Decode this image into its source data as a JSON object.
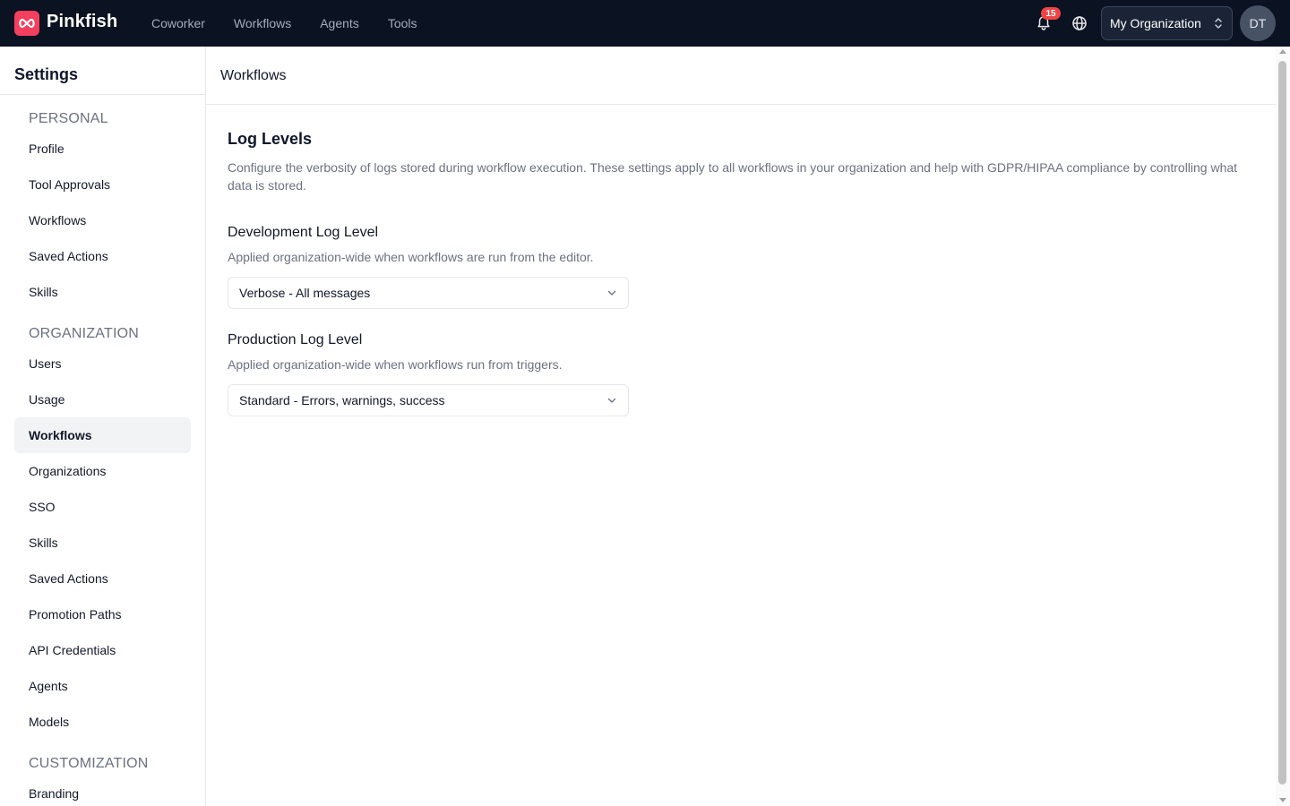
{
  "brand": {
    "name": "Pinkfish",
    "accent": "#f43f5e"
  },
  "topnav": [
    {
      "label": "Coworker"
    },
    {
      "label": "Workflows"
    },
    {
      "label": "Agents"
    },
    {
      "label": "Tools"
    }
  ],
  "header": {
    "notification_count": "15",
    "org_name": "My Organization",
    "avatar_initials": "DT"
  },
  "sidebar": {
    "title": "Settings",
    "sections": {
      "personal": {
        "heading": "PERSONAL",
        "items": [
          "Profile",
          "Tool Approvals",
          "Workflows",
          "Saved Actions",
          "Skills"
        ]
      },
      "organization": {
        "heading": "ORGANIZATION",
        "items": [
          "Users",
          "Usage",
          "Workflows",
          "Organizations",
          "SSO",
          "Skills",
          "Saved Actions",
          "Promotion Paths",
          "API Credentials",
          "Agents",
          "Models"
        ]
      },
      "customization": {
        "heading": "CUSTOMIZATION",
        "items": [
          "Branding"
        ]
      }
    },
    "active_item": "organization.Workflows"
  },
  "main": {
    "page_title": "Workflows",
    "section_title": "Log Levels",
    "section_description": "Configure the verbosity of logs stored during workflow execution. These settings apply to all workflows in your organization and help with GDPR/HIPAA compliance by controlling what data is stored.",
    "dev": {
      "label": "Development Log Level",
      "help": "Applied organization-wide when workflows are run from the editor.",
      "value": "Verbose - All messages"
    },
    "prod": {
      "label": "Production Log Level",
      "help": "Applied organization-wide when workflows run from triggers.",
      "value": "Standard - Errors, warnings, success"
    }
  }
}
